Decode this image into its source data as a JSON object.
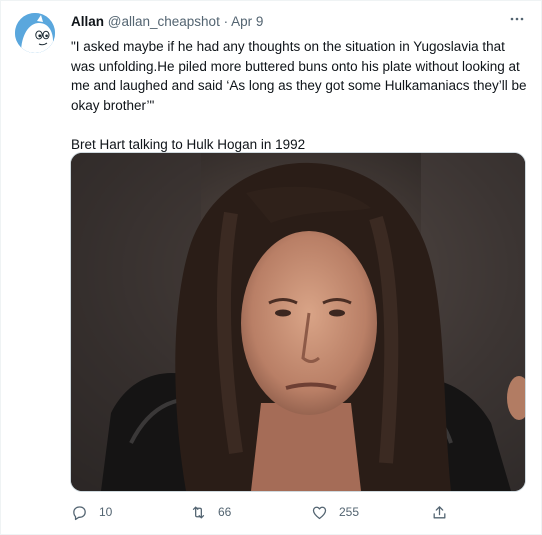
{
  "tweet": {
    "author_name": "Allan",
    "handle": "@allan_cheapshot",
    "separator": "·",
    "date": "Apr 9",
    "more_icon": "more-horizontal-icon",
    "text": "\"I asked maybe if he had any thoughts on the situation in Yugoslavia that was unfolding.He piled more buttered buns onto his plate without looking at me and laughed and said ‘As long as they got some Hulkamaniacs they’ll be okay brother’\"\n\nBret Hart talking to Hulk Hogan in 1992",
    "avatar_color": "#5aa7dd"
  },
  "actions": {
    "reply_count": "10",
    "retweet_count": "66",
    "like_count": "255",
    "reply_icon": "reply-icon",
    "retweet_icon": "retweet-icon",
    "like_icon": "heart-icon",
    "share_icon": "share-icon"
  }
}
